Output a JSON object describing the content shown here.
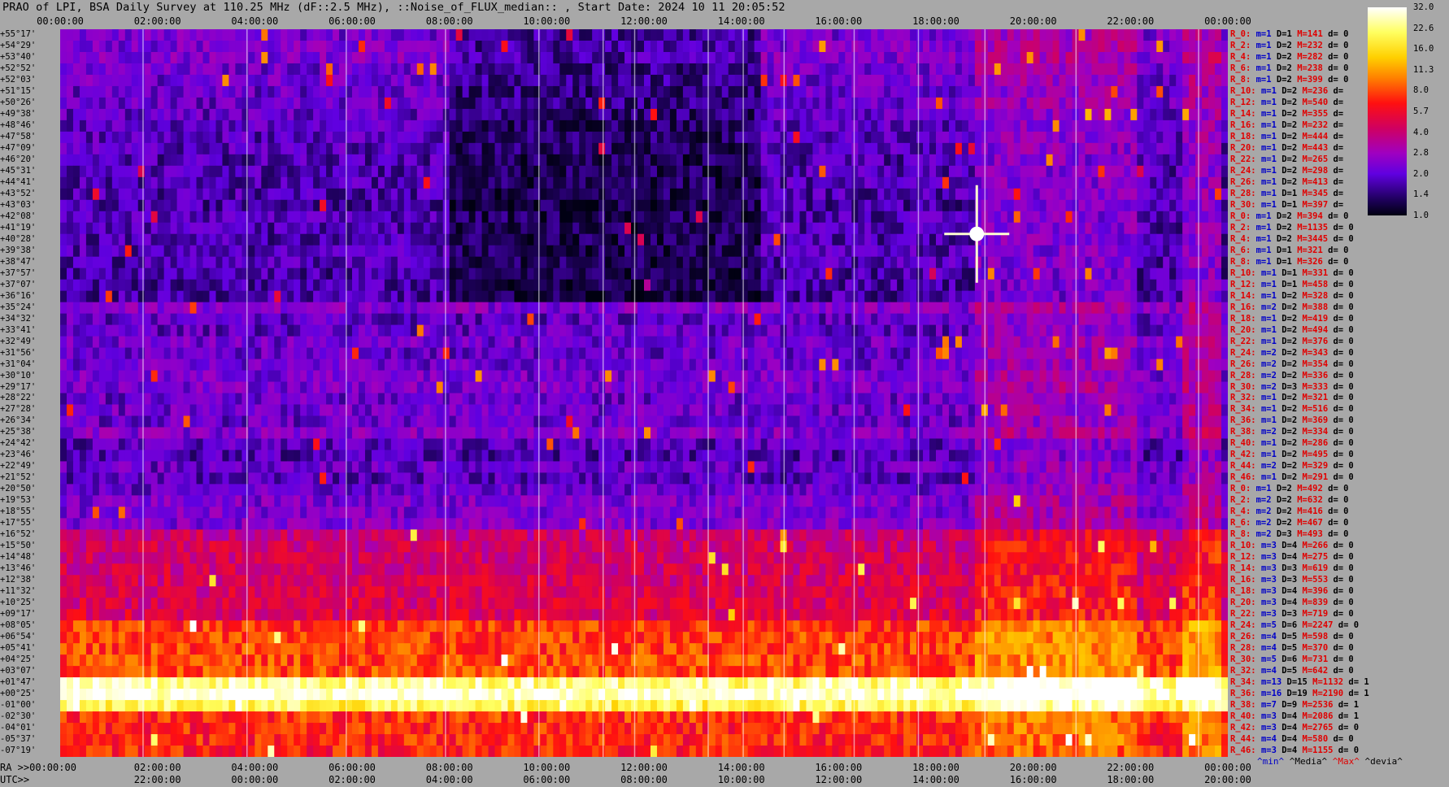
{
  "title": "PRAO of LPI, BSA Daily Survey at 110.25 MHz (dF::2.5 MHz), ::Noise_of_FLUX_median:: , Start Date: 2024 10 11 20:05:52",
  "top_ticks": [
    "00:00:00",
    "02:00:00",
    "04:00:00",
    "06:00:00",
    "08:00:00",
    "10:00:00",
    "12:00:00",
    "14:00:00",
    "16:00:00",
    "18:00:00",
    "20:00:00",
    "22:00:00",
    "00:00:00"
  ],
  "bottom_ra_label": "RA >>00:00:00",
  "bottom_ra_ticks": [
    "02:00:00",
    "04:00:00",
    "06:00:00",
    "08:00:00",
    "10:00:00",
    "12:00:00",
    "14:00:00",
    "16:00:00",
    "18:00:00",
    "20:00:00",
    "22:00:00",
    "00:00:00"
  ],
  "bottom_utc_label": "UTC>>",
  "bottom_utc_ticks": [
    "22:00:00",
    "00:00:00",
    "02:00:00",
    "04:00:00",
    "06:00:00",
    "08:00:00",
    "10:00:00",
    "12:00:00",
    "14:00:00",
    "16:00:00",
    "18:00:00",
    "20:00:00"
  ],
  "declinations": [
    "+55°17'",
    "+54°29'",
    "+53°40'",
    "+52°52'",
    "+52°03'",
    "+51°15'",
    "+50°26'",
    "+49°38'",
    "+48°46'",
    "+47°58'",
    "+47°09'",
    "+46°20'",
    "+45°31'",
    "+44°41'",
    "+43°52'",
    "+43°03'",
    "+42°08'",
    "+41°19'",
    "+40°28'",
    "+39°38'",
    "+38°47'",
    "+37°57'",
    "+37°07'",
    "+36°16'",
    "+35°24'",
    "+34°32'",
    "+33°41'",
    "+32°49'",
    "+31°56'",
    "+31°04'",
    "+30°10'",
    "+29°17'",
    "+28°22'",
    "+27°28'",
    "+26°34'",
    "+25°38'",
    "+24°42'",
    "+23°46'",
    "+22°49'",
    "+21°52'",
    "+20°50'",
    "+19°53'",
    "+18°55'",
    "+17°55'",
    "+16°52'",
    "+15°50'",
    "+14°48'",
    "+13°46'",
    "+12°38'",
    "+11°32'",
    "+10°25'",
    "+09°17'",
    "+08°05'",
    "+06°54'",
    "+05°41'",
    "+04°25'",
    "+03°07'",
    "+01°47'",
    "+00°25'",
    "-01°00'",
    "-02°30'",
    "-04°01'",
    "-05°37'",
    "-07°19'"
  ],
  "stats": [
    [
      "R_0:",
      "m=1",
      "D=1",
      "M=141",
      "d= 0"
    ],
    [
      "R_2:",
      "m=1",
      "D=2",
      "M=232",
      "d= 0"
    ],
    [
      "R_4:",
      "m=1",
      "D=2",
      "M=282",
      "d= 0"
    ],
    [
      "R_6:",
      "m=1",
      "D=2",
      "M=238",
      "d= 0"
    ],
    [
      "R_8:",
      "m=1",
      "D=2",
      "M=399",
      "d= 0"
    ],
    [
      "R_10:",
      "m=1",
      "D=2",
      "M=236",
      "d="
    ],
    [
      "R_12:",
      "m=1",
      "D=2",
      "M=540",
      "d="
    ],
    [
      "R_14:",
      "m=1",
      "D=2",
      "M=355",
      "d="
    ],
    [
      "R_16:",
      "m=1",
      "D=2",
      "M=232",
      "d="
    ],
    [
      "R_18:",
      "m=1",
      "D=2",
      "M=444",
      "d="
    ],
    [
      "R_20:",
      "m=1",
      "D=2",
      "M=443",
      "d="
    ],
    [
      "R_22:",
      "m=1",
      "D=2",
      "M=265",
      "d="
    ],
    [
      "R_24:",
      "m=1",
      "D=2",
      "M=298",
      "d="
    ],
    [
      "R_26:",
      "m=1",
      "D=2",
      "M=413",
      "d="
    ],
    [
      "R_28:",
      "m=1",
      "D=1",
      "M=345",
      "d="
    ],
    [
      "R_30:",
      "m=1",
      "D=1",
      "M=397",
      "d="
    ],
    [
      "R_0:",
      "m=1",
      "D=2",
      "M=394",
      "d= 0"
    ],
    [
      "R_2:",
      "m=1",
      "D=2",
      "M=1135",
      "d= 0"
    ],
    [
      "R_4:",
      "m=1",
      "D=2",
      "M=3445",
      "d= 0"
    ],
    [
      "R_6:",
      "m=1",
      "D=1",
      "M=321",
      "d= 0"
    ],
    [
      "R_8:",
      "m=1",
      "D=1",
      "M=326",
      "d= 0"
    ],
    [
      "R_10:",
      "m=1",
      "D=1",
      "M=331",
      "d= 0"
    ],
    [
      "R_12:",
      "m=1",
      "D=1",
      "M=458",
      "d= 0"
    ],
    [
      "R_14:",
      "m=1",
      "D=2",
      "M=328",
      "d= 0"
    ],
    [
      "R_16:",
      "m=2",
      "D=2",
      "M=388",
      "d= 0"
    ],
    [
      "R_18:",
      "m=1",
      "D=2",
      "M=419",
      "d= 0"
    ],
    [
      "R_20:",
      "m=1",
      "D=2",
      "M=494",
      "d= 0"
    ],
    [
      "R_22:",
      "m=1",
      "D=2",
      "M=376",
      "d= 0"
    ],
    [
      "R_24:",
      "m=2",
      "D=2",
      "M=343",
      "d= 0"
    ],
    [
      "R_26:",
      "m=2",
      "D=2",
      "M=354",
      "d= 0"
    ],
    [
      "R_28:",
      "m=2",
      "D=2",
      "M=336",
      "d= 0"
    ],
    [
      "R_30:",
      "m=2",
      "D=3",
      "M=333",
      "d= 0"
    ],
    [
      "R_32:",
      "m=1",
      "D=2",
      "M=321",
      "d= 0"
    ],
    [
      "R_34:",
      "m=1",
      "D=2",
      "M=516",
      "d= 0"
    ],
    [
      "R_36:",
      "m=1",
      "D=2",
      "M=369",
      "d= 0"
    ],
    [
      "R_38:",
      "m=2",
      "D=2",
      "M=334",
      "d= 0"
    ],
    [
      "R_40:",
      "m=1",
      "D=2",
      "M=286",
      "d= 0"
    ],
    [
      "R_42:",
      "m=1",
      "D=2",
      "M=495",
      "d= 0"
    ],
    [
      "R_44:",
      "m=2",
      "D=2",
      "M=329",
      "d= 0"
    ],
    [
      "R_46:",
      "m=1",
      "D=2",
      "M=291",
      "d= 0"
    ],
    [
      "R_0:",
      "m=1",
      "D=2",
      "M=492",
      "d= 0"
    ],
    [
      "R_2:",
      "m=2",
      "D=2",
      "M=632",
      "d= 0"
    ],
    [
      "R_4:",
      "m=2",
      "D=2",
      "M=416",
      "d= 0"
    ],
    [
      "R_6:",
      "m=2",
      "D=2",
      "M=467",
      "d= 0"
    ],
    [
      "R_8:",
      "m=2",
      "D=3",
      "M=493",
      "d= 0"
    ],
    [
      "R_10:",
      "m=3",
      "D=4",
      "M=266",
      "d= 0"
    ],
    [
      "R_12:",
      "m=3",
      "D=4",
      "M=275",
      "d= 0"
    ],
    [
      "R_14:",
      "m=3",
      "D=3",
      "M=619",
      "d= 0"
    ],
    [
      "R_16:",
      "m=3",
      "D=3",
      "M=553",
      "d= 0"
    ],
    [
      "R_18:",
      "m=3",
      "D=4",
      "M=396",
      "d= 0"
    ],
    [
      "R_20:",
      "m=3",
      "D=4",
      "M=839",
      "d= 0"
    ],
    [
      "R_22:",
      "m=3",
      "D=3",
      "M=719",
      "d= 0"
    ],
    [
      "R_24:",
      "m=5",
      "D=6",
      "M=2247",
      "d= 0"
    ],
    [
      "R_26:",
      "m=4",
      "D=5",
      "M=598",
      "d= 0"
    ],
    [
      "R_28:",
      "m=4",
      "D=5",
      "M=370",
      "d= 0"
    ],
    [
      "R_30:",
      "m=5",
      "D=6",
      "M=731",
      "d= 0"
    ],
    [
      "R_32:",
      "m=4",
      "D=5",
      "M=642",
      "d= 0"
    ],
    [
      "R_34:",
      "m=13",
      "D=15",
      "M=1132",
      "d= 1"
    ],
    [
      "R_36:",
      "m=16",
      "D=19",
      "M=2190",
      "d= 1"
    ],
    [
      "R_38:",
      "m=7",
      "D=9",
      "M=2536",
      "d= 1"
    ],
    [
      "R_40:",
      "m=3",
      "D=4",
      "M=2086",
      "d= 1"
    ],
    [
      "R_42:",
      "m=3",
      "D=4",
      "M=2765",
      "d= 0"
    ],
    [
      "R_44:",
      "m=4",
      "D=4",
      "M=580",
      "d= 0"
    ],
    [
      "R_46:",
      "m=3",
      "D=4",
      "M=1155",
      "d= 0"
    ]
  ],
  "footer": {
    "min": "^min^",
    "median": "^Media^",
    "max": "^Max^",
    "dev": "^devia^"
  },
  "colorbar": {
    "labels": [
      "32.0",
      "22.6",
      "16.0",
      "11.3",
      "8.0",
      "5.7",
      "4.0",
      "2.8",
      "2.0",
      "1.4",
      "1.0"
    ],
    "colors": [
      "#ffffff",
      "#ffff60",
      "#ffd000",
      "#ff8000",
      "#ff1010",
      "#d00060",
      "#a000c0",
      "#6000e0",
      "#200060",
      "#000010"
    ]
  },
  "chart_data": {
    "type": "heatmap",
    "x_range_ra": [
      "00:00:00",
      "00:00:00"
    ],
    "y_labels_declination": "see declinations",
    "rows": 64,
    "row_levels": [
      2.4,
      2.5,
      2.6,
      2.3,
      2.3,
      2.2,
      2.2,
      2.1,
      2.0,
      2.0,
      2.0,
      1.9,
      1.9,
      1.9,
      1.9,
      1.8,
      1.9,
      1.9,
      1.9,
      1.9,
      1.9,
      1.8,
      1.8,
      1.8,
      2.6,
      2.1,
      2.1,
      2.3,
      2.2,
      2.3,
      2.4,
      2.5,
      2.2,
      2.3,
      2.2,
      2.6,
      2.0,
      1.9,
      2.2,
      2.0,
      2.2,
      2.5,
      2.5,
      2.6,
      4.2,
      4.5,
      4.5,
      4.6,
      4.7,
      4.8,
      4.9,
      5.0,
      7.5,
      7.8,
      7.9,
      8.0,
      8.2,
      24.0,
      30.0,
      20.0,
      7.5,
      7.0,
      7.0,
      6.8
    ],
    "scale": "log",
    "colorbar_range": [
      1.0,
      32.0
    ]
  }
}
